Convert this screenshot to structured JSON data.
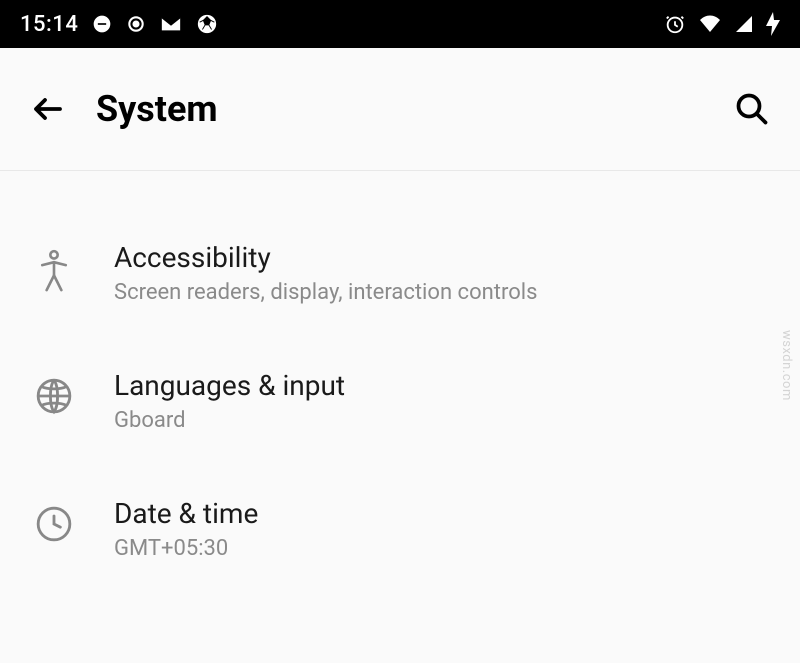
{
  "statusbar": {
    "time": "15:14"
  },
  "header": {
    "title": "System"
  },
  "settings": {
    "items": [
      {
        "title": "Accessibility",
        "subtitle": "Screen readers, display, interaction controls"
      },
      {
        "title": "Languages & input",
        "subtitle": "Gboard"
      },
      {
        "title": "Date & time",
        "subtitle": "GMT+05:30"
      }
    ]
  },
  "watermark": "wsxdn.com"
}
